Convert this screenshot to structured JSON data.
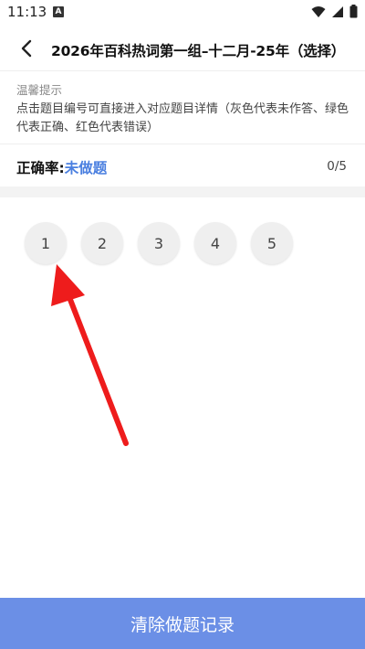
{
  "status_bar": {
    "time": "11:13",
    "app_icon_letter": "A",
    "icons": [
      "wifi-icon",
      "signal-icon",
      "battery-icon"
    ]
  },
  "header": {
    "back_icon": "chevron-left-icon",
    "title": "2026年百科热词第一组–十二月-25年（选择）"
  },
  "tips": {
    "title": "温馨提示",
    "text": "点击题目编号可直接进入对应题目详情（灰色代表未作答、绿色代表正确、红色代表错误）"
  },
  "accuracy": {
    "label": "正确率:",
    "value": "未做题",
    "progress": "0/5"
  },
  "questions": [
    "1",
    "2",
    "3",
    "4",
    "5"
  ],
  "bottom": {
    "clear_button_label": "清除做题记录"
  },
  "colors": {
    "accent": "#4a7fe0",
    "button": "#6b8fe6",
    "annotation_arrow": "#ee1c1c",
    "unanswered": "#efefef"
  }
}
